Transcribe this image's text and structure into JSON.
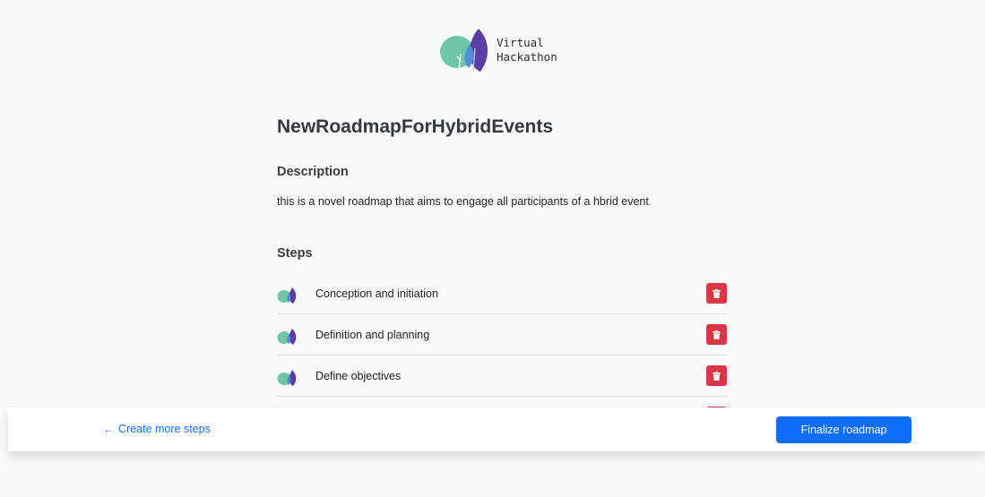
{
  "brand": {
    "logo_icon": "tree-leaves-logo-icon",
    "line1": "Virtual",
    "line2": "Hackathon",
    "colors": {
      "teal": "#6fc7a8",
      "purple": "#5b3ea6",
      "blue": "#4f8fd8"
    }
  },
  "roadmap": {
    "title": "NewRoadmapForHybridEvents",
    "description_heading": "Description",
    "description": "this is a novel roadmap that aims to engage all participants of a hbrid event",
    "steps_heading": "Steps",
    "steps": [
      {
        "label": "Conception and initiation",
        "icon": "tree-leaves-icon",
        "action_icon": "trash-icon"
      },
      {
        "label": "Definition and planning",
        "icon": "tree-leaves-icon",
        "action_icon": "trash-icon"
      },
      {
        "label": "Define objectives",
        "icon": "tree-leaves-icon",
        "action_icon": "trash-icon"
      },
      {
        "label": "",
        "icon": "tree-leaves-icon",
        "action_icon": "trash-icon"
      }
    ]
  },
  "footer": {
    "back_icon": "arrow-left-icon",
    "create_more_label": "Create more steps",
    "finalize_label": "Finalize roadmap",
    "colors": {
      "primary": "#0d6efd",
      "danger": "#dc3545"
    }
  }
}
